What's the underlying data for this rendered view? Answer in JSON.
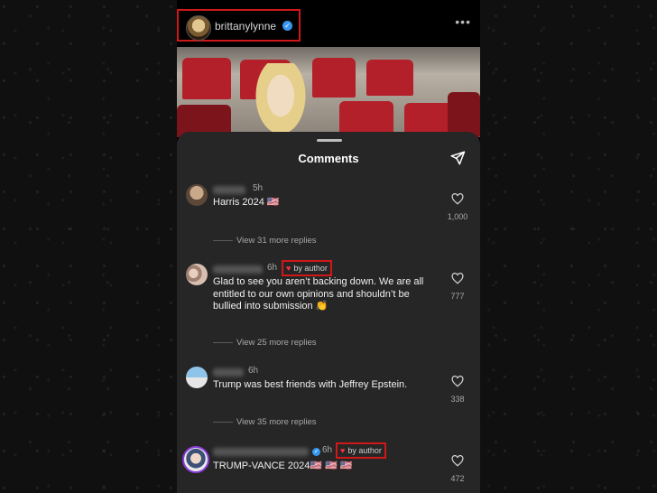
{
  "post": {
    "author_username": "brittanylynne",
    "verified_icon": "verified-badge-icon",
    "more_icon": "more-horizontal-icon",
    "more_label": "•••"
  },
  "comments_sheet": {
    "title": "Comments",
    "share_icon": "send-icon"
  },
  "comments": [
    {
      "time": "5h",
      "text": "Harris 2024 🇺🇸",
      "likes": "1,000",
      "replies_label": "View 31 more replies"
    },
    {
      "time": "6h",
      "badge": "by author",
      "text": "Glad to see you aren’t backing down. We are all entitled to our own opinions and shouldn’t be bullied into submission 👏",
      "likes": "777",
      "replies_label": "View 25 more replies"
    },
    {
      "time": "6h",
      "text": "Trump was best friends with Jeffrey Epstein.",
      "likes": "338",
      "replies_label": "View 35 more replies"
    },
    {
      "time": "6h",
      "badge": "by author",
      "text": "TRUMP-VANCE 2024🇺🇸 🇺🇸 🇺🇸",
      "likes": "472"
    }
  ],
  "colors": {
    "highlight_box": "#d01818",
    "heart": "#ff3040",
    "sheet_bg": "#262626"
  }
}
